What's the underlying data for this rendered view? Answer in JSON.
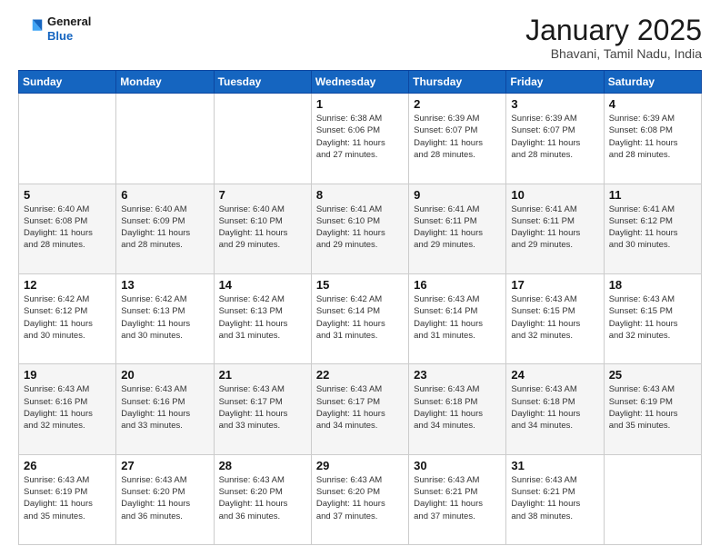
{
  "header": {
    "logo_line1": "General",
    "logo_line2": "Blue",
    "title": "January 2025",
    "subtitle": "Bhavani, Tamil Nadu, India"
  },
  "days_of_week": [
    "Sunday",
    "Monday",
    "Tuesday",
    "Wednesday",
    "Thursday",
    "Friday",
    "Saturday"
  ],
  "weeks": [
    [
      {
        "day": "",
        "info": ""
      },
      {
        "day": "",
        "info": ""
      },
      {
        "day": "",
        "info": ""
      },
      {
        "day": "1",
        "info": "Sunrise: 6:38 AM\nSunset: 6:06 PM\nDaylight: 11 hours\nand 27 minutes."
      },
      {
        "day": "2",
        "info": "Sunrise: 6:39 AM\nSunset: 6:07 PM\nDaylight: 11 hours\nand 28 minutes."
      },
      {
        "day": "3",
        "info": "Sunrise: 6:39 AM\nSunset: 6:07 PM\nDaylight: 11 hours\nand 28 minutes."
      },
      {
        "day": "4",
        "info": "Sunrise: 6:39 AM\nSunset: 6:08 PM\nDaylight: 11 hours\nand 28 minutes."
      }
    ],
    [
      {
        "day": "5",
        "info": "Sunrise: 6:40 AM\nSunset: 6:08 PM\nDaylight: 11 hours\nand 28 minutes."
      },
      {
        "day": "6",
        "info": "Sunrise: 6:40 AM\nSunset: 6:09 PM\nDaylight: 11 hours\nand 28 minutes."
      },
      {
        "day": "7",
        "info": "Sunrise: 6:40 AM\nSunset: 6:10 PM\nDaylight: 11 hours\nand 29 minutes."
      },
      {
        "day": "8",
        "info": "Sunrise: 6:41 AM\nSunset: 6:10 PM\nDaylight: 11 hours\nand 29 minutes."
      },
      {
        "day": "9",
        "info": "Sunrise: 6:41 AM\nSunset: 6:11 PM\nDaylight: 11 hours\nand 29 minutes."
      },
      {
        "day": "10",
        "info": "Sunrise: 6:41 AM\nSunset: 6:11 PM\nDaylight: 11 hours\nand 29 minutes."
      },
      {
        "day": "11",
        "info": "Sunrise: 6:41 AM\nSunset: 6:12 PM\nDaylight: 11 hours\nand 30 minutes."
      }
    ],
    [
      {
        "day": "12",
        "info": "Sunrise: 6:42 AM\nSunset: 6:12 PM\nDaylight: 11 hours\nand 30 minutes."
      },
      {
        "day": "13",
        "info": "Sunrise: 6:42 AM\nSunset: 6:13 PM\nDaylight: 11 hours\nand 30 minutes."
      },
      {
        "day": "14",
        "info": "Sunrise: 6:42 AM\nSunset: 6:13 PM\nDaylight: 11 hours\nand 31 minutes."
      },
      {
        "day": "15",
        "info": "Sunrise: 6:42 AM\nSunset: 6:14 PM\nDaylight: 11 hours\nand 31 minutes."
      },
      {
        "day": "16",
        "info": "Sunrise: 6:43 AM\nSunset: 6:14 PM\nDaylight: 11 hours\nand 31 minutes."
      },
      {
        "day": "17",
        "info": "Sunrise: 6:43 AM\nSunset: 6:15 PM\nDaylight: 11 hours\nand 32 minutes."
      },
      {
        "day": "18",
        "info": "Sunrise: 6:43 AM\nSunset: 6:15 PM\nDaylight: 11 hours\nand 32 minutes."
      }
    ],
    [
      {
        "day": "19",
        "info": "Sunrise: 6:43 AM\nSunset: 6:16 PM\nDaylight: 11 hours\nand 32 minutes."
      },
      {
        "day": "20",
        "info": "Sunrise: 6:43 AM\nSunset: 6:16 PM\nDaylight: 11 hours\nand 33 minutes."
      },
      {
        "day": "21",
        "info": "Sunrise: 6:43 AM\nSunset: 6:17 PM\nDaylight: 11 hours\nand 33 minutes."
      },
      {
        "day": "22",
        "info": "Sunrise: 6:43 AM\nSunset: 6:17 PM\nDaylight: 11 hours\nand 34 minutes."
      },
      {
        "day": "23",
        "info": "Sunrise: 6:43 AM\nSunset: 6:18 PM\nDaylight: 11 hours\nand 34 minutes."
      },
      {
        "day": "24",
        "info": "Sunrise: 6:43 AM\nSunset: 6:18 PM\nDaylight: 11 hours\nand 34 minutes."
      },
      {
        "day": "25",
        "info": "Sunrise: 6:43 AM\nSunset: 6:19 PM\nDaylight: 11 hours\nand 35 minutes."
      }
    ],
    [
      {
        "day": "26",
        "info": "Sunrise: 6:43 AM\nSunset: 6:19 PM\nDaylight: 11 hours\nand 35 minutes."
      },
      {
        "day": "27",
        "info": "Sunrise: 6:43 AM\nSunset: 6:20 PM\nDaylight: 11 hours\nand 36 minutes."
      },
      {
        "day": "28",
        "info": "Sunrise: 6:43 AM\nSunset: 6:20 PM\nDaylight: 11 hours\nand 36 minutes."
      },
      {
        "day": "29",
        "info": "Sunrise: 6:43 AM\nSunset: 6:20 PM\nDaylight: 11 hours\nand 37 minutes."
      },
      {
        "day": "30",
        "info": "Sunrise: 6:43 AM\nSunset: 6:21 PM\nDaylight: 11 hours\nand 37 minutes."
      },
      {
        "day": "31",
        "info": "Sunrise: 6:43 AM\nSunset: 6:21 PM\nDaylight: 11 hours\nand 38 minutes."
      },
      {
        "day": "",
        "info": ""
      }
    ]
  ]
}
